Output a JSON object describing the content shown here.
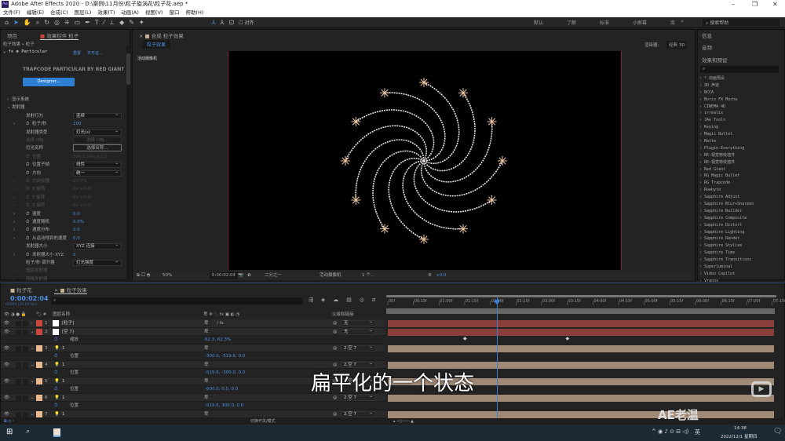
{
  "window": {
    "title": "Adobe After Effects 2020 - D:\\案例\\11月份\\粒子旋涡花\\粒子花.aep *",
    "logo": "Ae"
  },
  "menu": [
    "文件(F)",
    "编辑(E)",
    "合成(C)",
    "图层(L)",
    "效果(T)",
    "动画(A)",
    "视图(V)",
    "窗口",
    "帮助(H)"
  ],
  "toolbar": {
    "align_label": "对齐",
    "workspaces": [
      "默认",
      "了解",
      "标准",
      "小屏幕",
      "库"
    ],
    "more": "»",
    "search_placeholder": "搜索帮助"
  },
  "left_panel": {
    "tabs": [
      "项目",
      "效果控件 粒子"
    ],
    "breadcrumb": "粒子效果 • 粒子",
    "effect_name": "Particular",
    "reset": "重置",
    "license": "许可证...",
    "banner": "TRAPCODE PARTICULAR BY RED GIANT",
    "designer_button": "Designer...",
    "props": [
      {
        "label": "显示系统",
        "indent": 1,
        "arrow": ">"
      },
      {
        "label": "发射器",
        "indent": 1,
        "arrow": "v"
      },
      {
        "label": "发射行为",
        "indent": 2,
        "dropdown": "连续"
      },
      {
        "label": "粒子/秒",
        "indent": 2,
        "arrow": ">",
        "stopwatch": true,
        "value": "100"
      },
      {
        "label": "发射器类型",
        "indent": 2,
        "dropdown": "灯光(s)"
      },
      {
        "label": "选择 OBJ",
        "indent": 2,
        "disabled": true,
        "button": "选择 OBJ..."
      },
      {
        "label": "灯光名称",
        "indent": 2,
        "button": "选择名称..."
      },
      {
        "label": "位置",
        "indent": 2,
        "stopwatch": true,
        "disabled": true,
        "value": "960.0,540.0,0.0"
      },
      {
        "label": "位置子帧",
        "indent": 2,
        "stopwatch": true,
        "dropdown": "线性"
      },
      {
        "label": "方向",
        "indent": 2,
        "stopwatch": true,
        "dropdown": "统一"
      },
      {
        "label": "方向传播",
        "indent": 2,
        "arrow": ">",
        "stopwatch": true,
        "disabled": true,
        "value": "20.0%"
      },
      {
        "label": "X 旋转",
        "indent": 2,
        "arrow": ">",
        "stopwatch": true,
        "disabled": true,
        "value": "0x +0.0°"
      },
      {
        "label": "Y 旋转",
        "indent": 2,
        "arrow": ">",
        "stopwatch": true,
        "disabled": true,
        "value": "0x +0.0°"
      },
      {
        "label": "Z 旋转",
        "indent": 2,
        "arrow": ">",
        "stopwatch": true,
        "disabled": true,
        "value": "0x +0.0°"
      },
      {
        "label": "速度",
        "indent": 2,
        "arrow": ">",
        "stopwatch": true,
        "value": "0.0"
      },
      {
        "label": "速度随机",
        "indent": 2,
        "arrow": ">",
        "stopwatch": true,
        "value": "0.0%"
      },
      {
        "label": "速度分布",
        "indent": 2,
        "arrow": ">",
        "stopwatch": true,
        "value": "0.0"
      },
      {
        "label": "从运动得到的速度",
        "indent": 2,
        "arrow": ">",
        "stopwatch": true,
        "value": "0.0"
      },
      {
        "label": "发射器大小",
        "indent": 2,
        "dropdown": "XYZ 连接"
      },
      {
        "label": "发射器大小 XYZ",
        "indent": 2,
        "arrow": ">",
        "stopwatch": true,
        "value": "0"
      },
      {
        "label": "粒子/秒 调节器",
        "indent": 2,
        "dropdown": "灯光强度"
      },
      {
        "label": "图层发射器",
        "indent": 2,
        "arrow": ">",
        "disabled": true
      },
      {
        "label": "网格发射器",
        "indent": 2,
        "arrow": ">",
        "disabled": true
      }
    ]
  },
  "comp_panel": {
    "tab": "合成 粒子效果",
    "subtab": "粒子效果",
    "renderer_label": "渲染器:",
    "renderer": "经典 3D",
    "camera_label": "活动摄像机",
    "footer": {
      "zoom": "50%",
      "timecode": "0:00:02:04",
      "resolution": "二分之一",
      "view": "活动摄像机",
      "views": "1 个...",
      "exposure": "+0.0"
    }
  },
  "right_panel": {
    "tabs": [
      "信息",
      "音频",
      "效果和预设"
    ],
    "effects": [
      "* 动画预设",
      "3D 声道",
      "BCCA",
      "Boris FX Mocha",
      "CINEMA 4D",
      "irrealix",
      "JAe Tools",
      "Keying",
      "Magic Bullet",
      "Matte",
      "Plugin Everything",
      "RE:视觉特效插件",
      "RE:视觉特效插件",
      "Red Giant",
      "RG Magic Bullet",
      "RG Trapcode",
      "Rowbyte",
      "Sapphire Adjust",
      "Sapphire Blur+Sharpen",
      "Sapphire Builder",
      "Sapphire Composite",
      "Sapphire Distort",
      "Sapphire Lighting",
      "Sapphire Render",
      "Sapphire Stylize",
      "Sapphire Time",
      "Sapphire Transitions",
      "Superluminal",
      "Video Copilot",
      "Vranos"
    ]
  },
  "timeline": {
    "tabs": [
      "粒子花",
      "粒子效果"
    ],
    "timecode": "0:00:02:04",
    "frames": "00064 (30.00 fps)",
    "col_name": "图层名称",
    "col_parent": "父级和链接",
    "ruler": [
      "00f",
      "00:15f",
      "01:00f",
      "01:15f",
      "02:00f",
      "02:15f",
      "03:00f",
      "03:15f",
      "04:00f",
      "04:15f",
      "05:00f",
      "05:15f",
      "06:00f",
      "06:15f",
      "07:00f",
      "07:15f",
      "08:00f",
      "08:15f",
      "09:0"
    ],
    "current_time_seconds": 2.13,
    "rows": [
      {
        "type": "layer",
        "num": "1",
        "name": "[粒子]",
        "color": "#c9463d",
        "parent": "无",
        "fx": true,
        "bar": "#8a3f3a"
      },
      {
        "type": "layer",
        "num": "2",
        "name": "[空 7]",
        "color": "#c9463d",
        "parent": "无",
        "bar": "#8a3f3a"
      },
      {
        "type": "prop",
        "name": "缩放",
        "value": "62.3, 62.3%",
        "keyframes_seconds": [
          1.5,
          3.5
        ]
      },
      {
        "type": "layer",
        "num": "3",
        "name": "1",
        "color": "#e8b98f",
        "parent": "2.空 7",
        "bar": "#a08a76"
      },
      {
        "type": "prop",
        "name": "位置",
        "value": "-300.0, -519.6, 0.0"
      },
      {
        "type": "layer",
        "num": "4",
        "name": "1",
        "color": "#e8b98f",
        "parent": "2.空 7",
        "bar": "#a08a76"
      },
      {
        "type": "prop",
        "name": "位置",
        "value": "-519.6, -300.0, 0.0"
      },
      {
        "type": "layer",
        "num": "5",
        "name": "1",
        "color": "#e8b98f",
        "parent": "2.空 7",
        "bar": "#a08a76"
      },
      {
        "type": "prop",
        "name": "位置",
        "value": "-600.0, 0.0, 0.0"
      },
      {
        "type": "layer",
        "num": "6",
        "name": "1",
        "color": "#e8b98f",
        "parent": "2.空 7",
        "bar": "#a08a76"
      },
      {
        "type": "prop",
        "name": "位置",
        "value": "-519.6, 300.0, 0.0"
      },
      {
        "type": "layer",
        "num": "7",
        "name": "1",
        "color": "#e8b98f",
        "parent": "2.空 7",
        "bar": "#a08a76"
      }
    ],
    "footer_toggle": "切换开关/模式"
  },
  "subtitle": "扁平化的一个状态",
  "watermark": "AE老温",
  "taskbar": {
    "time": "14:38",
    "date": "2022/12/1 星期四",
    "ime": "英"
  },
  "colors": {
    "accent": "#2d8ceb",
    "timecode": "#4d8fe0",
    "panel": "#232323"
  }
}
